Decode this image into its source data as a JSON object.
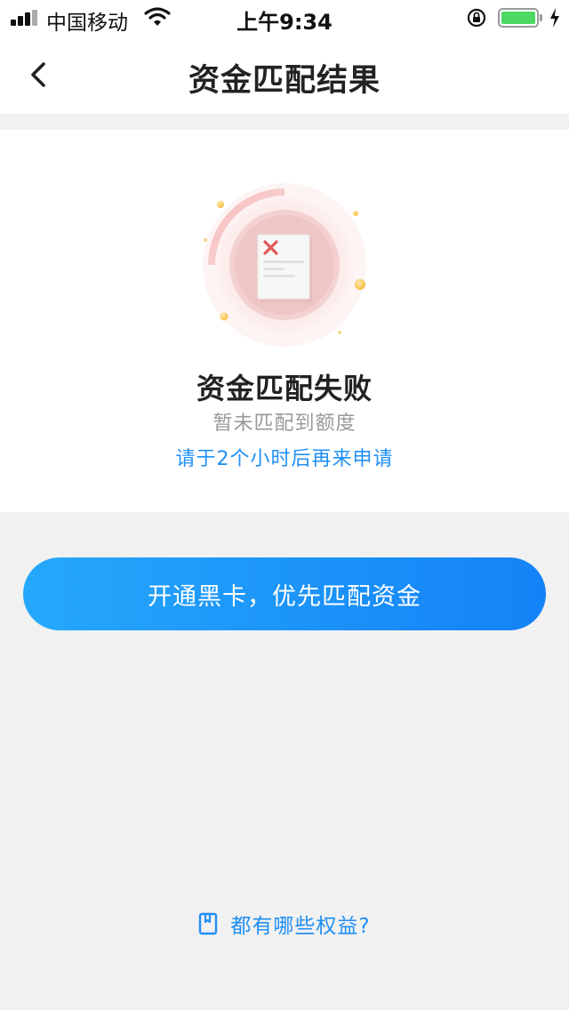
{
  "status_bar": {
    "carrier": "中国移动",
    "time": "上午9:34",
    "battery_color": "#4cd964"
  },
  "nav": {
    "title": "资金匹配结果",
    "back_icon": "chevron-left-icon"
  },
  "result": {
    "illustration_icon": "failed-document-icon",
    "title": "资金匹配失败",
    "subtitle": "暂未匹配到额度",
    "hint": "请于2个小时后再来申请"
  },
  "cta": {
    "label": "开通黑卡，优先匹配资金",
    "gradient": [
      "#25a8fb",
      "#1482f7"
    ]
  },
  "benefits": {
    "icon": "book-icon",
    "label": "都有哪些权益?"
  },
  "colors": {
    "accent": "#1f8ff5",
    "error": "#e05a5a",
    "background": "#f1f1f1"
  }
}
